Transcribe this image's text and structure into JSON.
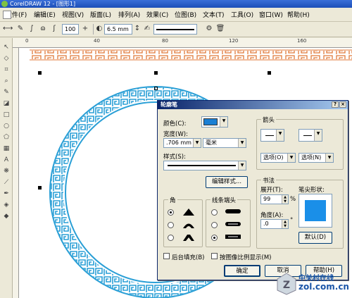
{
  "window": {
    "title": "CorelDRAW 12 - [图形1]"
  },
  "menu": [
    "文件(F)",
    "编辑(E)",
    "视图(V)",
    "版面(L)",
    "排列(A)",
    "效果(C)",
    "位图(B)",
    "文本(T)",
    "工具(O)",
    "窗口(W)",
    "帮助(H)"
  ],
  "toolbar": {
    "zoom_value": "100",
    "outline_width": "6.5 mm"
  },
  "dialog": {
    "title": "轮廓笔",
    "color_label": "颜色(C):",
    "color_swatch": "#1a7fd4",
    "width_label": "宽度(W):",
    "width_value": ".706 mm",
    "unit_value": "毫米",
    "style_label": "样式(S):",
    "edit_style_button": "编辑样式...",
    "arrows_title": "箭头",
    "options_left": "选项(O)",
    "options_right": "选项(N)",
    "calligraphy_title": "书法",
    "stretch_label": "展开(T):",
    "stretch_value": "99",
    "percent": "%",
    "nib_label": "笔尖形状:",
    "angle_label": "角度(A):",
    "angle_value": ".0",
    "degree": "°",
    "default_button": "默认(D)",
    "corners_title": "角",
    "line_caps_title": "线条端头",
    "behind_fill_label": "后台填充(B)",
    "scale_with_image_label": "按图像比例显示(M)",
    "ok_button": "确定",
    "cancel_button": "取消",
    "help_button": "帮助(H)",
    "nib_color": "#1a8fe8"
  },
  "watermark": {
    "brand": "中关村在线",
    "url": "zol.com.cn"
  },
  "colors": {
    "accent_blue": "#2a9fd6",
    "border_orange": "#e07a3a"
  }
}
